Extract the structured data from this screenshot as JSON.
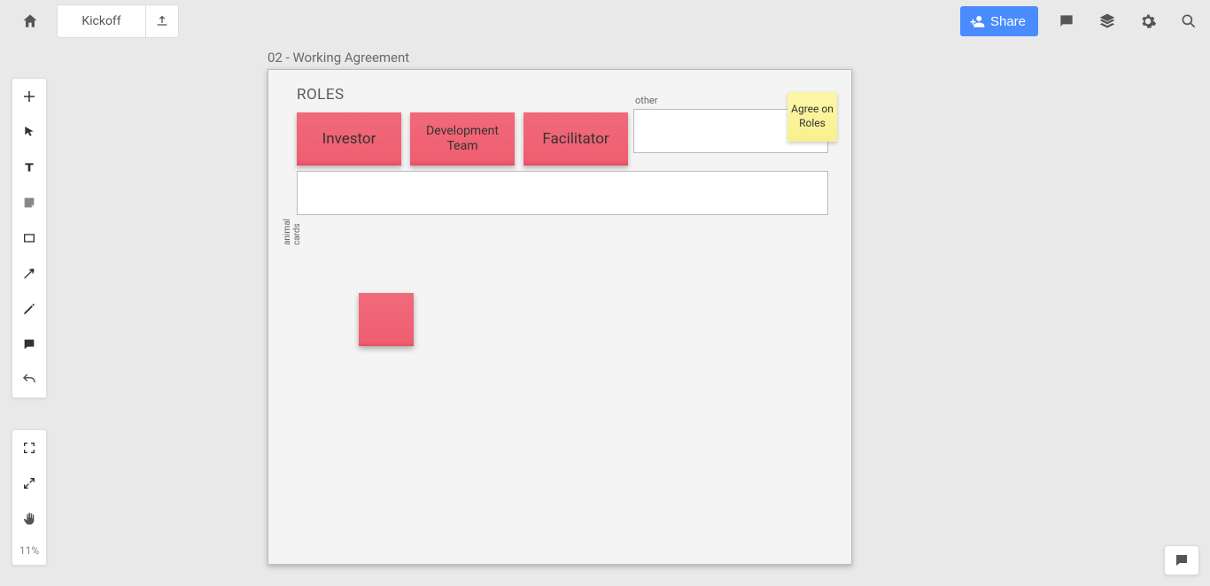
{
  "header": {
    "board_title": "Kickoff",
    "share_label": "Share"
  },
  "zoom": {
    "level": "11%"
  },
  "canvas": {
    "title": "02 - Working Agreement",
    "section_roles": "ROLES",
    "other_label": "other",
    "animal_label": "animal cards",
    "stickies": {
      "investor": "Investor",
      "dev_team": "Development Team",
      "facilitator": "Facilitator",
      "agree_roles": "Agree on Roles"
    }
  }
}
